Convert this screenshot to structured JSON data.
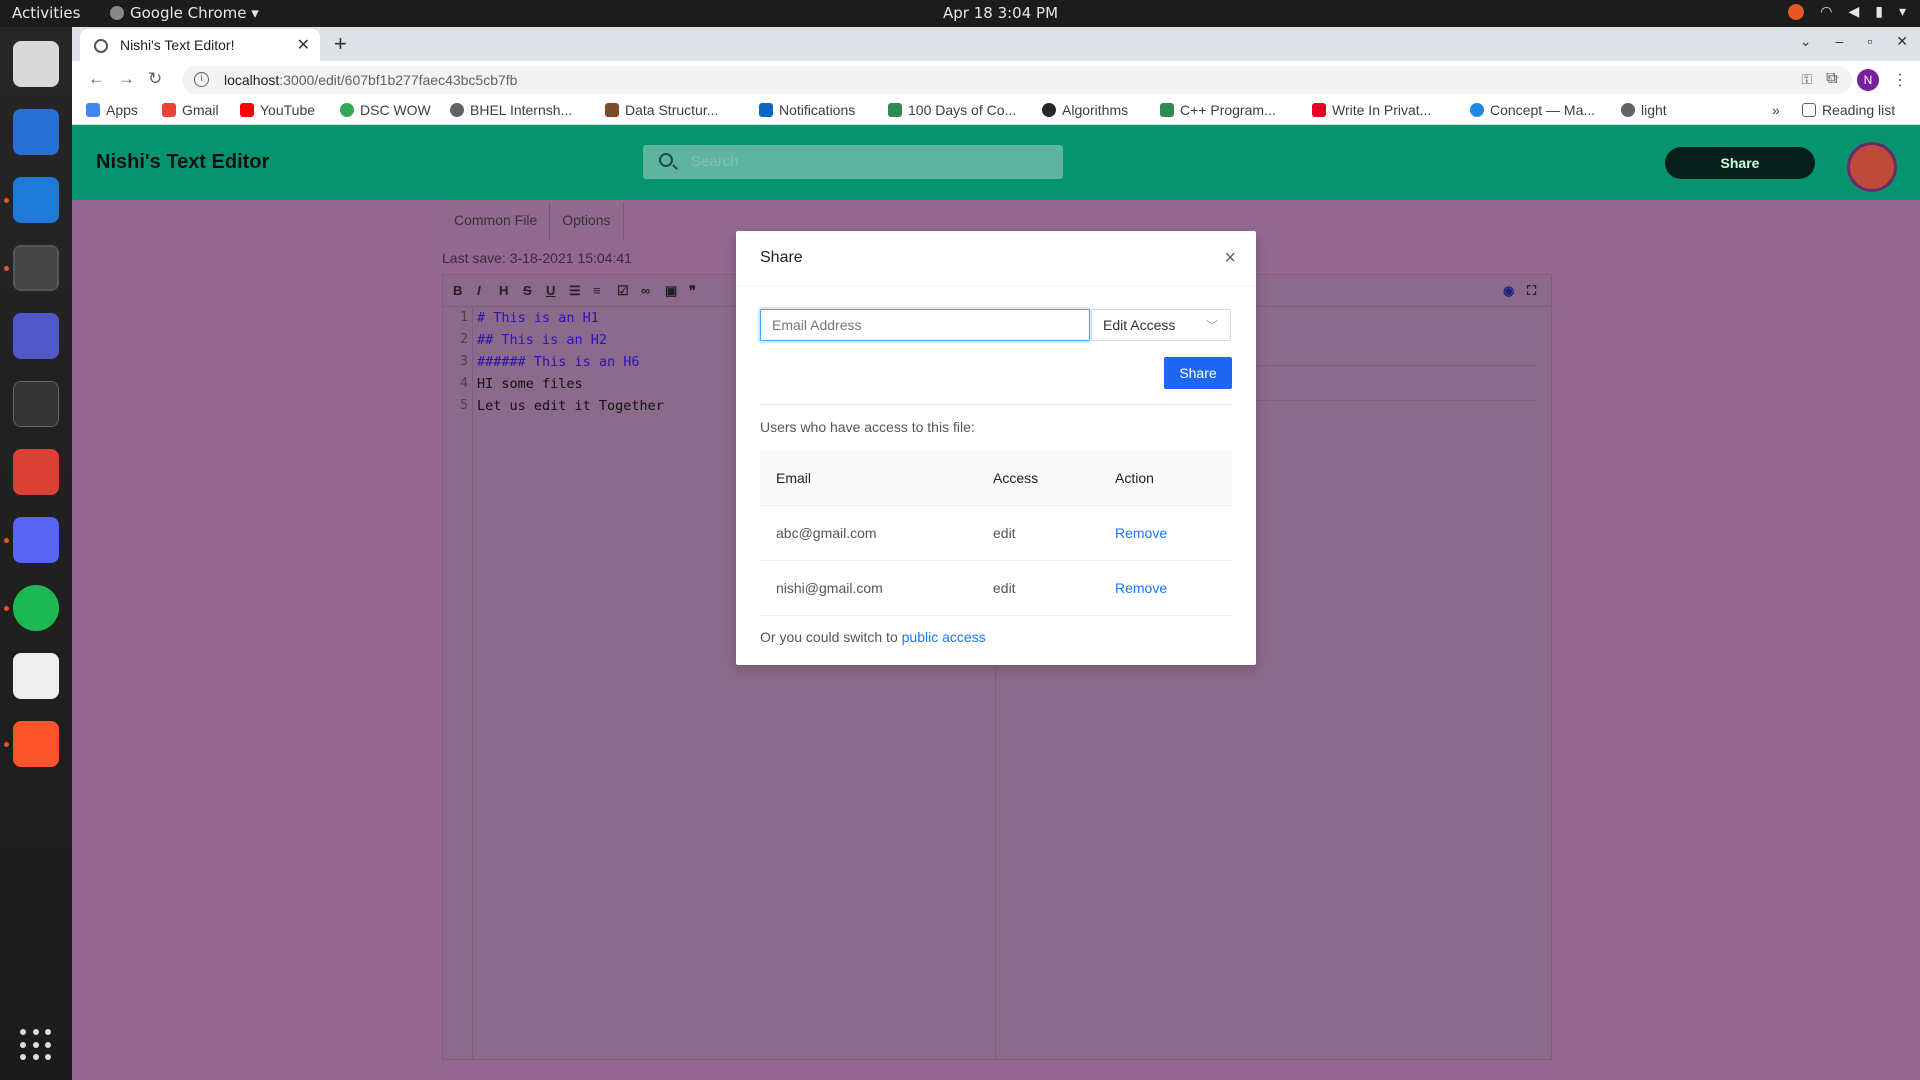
{
  "system": {
    "activities": "Activities",
    "app_name": "Google Chrome",
    "clock": "Apr 18  3:04 PM"
  },
  "browser": {
    "tab_title": "Nishi's Text Editor!",
    "url_host": "localhost",
    "url_rest": ":3000/edit/607bf1b277faec43bc5cb7fb",
    "profile_initial": "N",
    "bookmarks": [
      {
        "label": "Apps",
        "color": "#4285f4"
      },
      {
        "label": "Gmail",
        "color": "#ea4335"
      },
      {
        "label": "YouTube",
        "color": "#ff0000"
      },
      {
        "label": "DSC WOW",
        "color": "#34a853"
      },
      {
        "label": "BHEL Internsh...",
        "color": "#5f6368"
      },
      {
        "label": "Data Structur...",
        "color": "#7a4a2a"
      },
      {
        "label": "Notifications",
        "color": "#0a66c2"
      },
      {
        "label": "100 Days of Co...",
        "color": "#2e8b57"
      },
      {
        "label": "Algorithms",
        "color": "#24292e"
      },
      {
        "label": "C++ Program...",
        "color": "#2e8b57"
      },
      {
        "label": "Write In Privat...",
        "color": "#e60023"
      },
      {
        "label": "Concept — Ma...",
        "color": "#1e88e5"
      },
      {
        "label": "light",
        "color": "#5f6368"
      }
    ],
    "more": "»",
    "reading_list": "Reading list"
  },
  "app": {
    "brand": "Nishi's Text Editor",
    "search_placeholder": "Search",
    "share_button": "Share",
    "file_tabs": [
      "Common File",
      "Options"
    ],
    "last_save": "Last save: 3-18-2021 15:04:41",
    "code_lines": [
      {
        "text": "# This is an H1",
        "heading": true
      },
      {
        "text": "## This is an H2",
        "heading": true
      },
      {
        "text": "###### This is an H6",
        "heading": true
      },
      {
        "text": "HI some files",
        "heading": false
      },
      {
        "text": "Let us edit it Together",
        "heading": false
      }
    ]
  },
  "modal": {
    "title": "Share",
    "close": "×",
    "email_placeholder": "Email Address",
    "access_select": "Edit Access",
    "share_button": "Share",
    "users_text": "Users who have access to this file:",
    "columns": [
      "Email",
      "Access",
      "Action"
    ],
    "rows": [
      {
        "email": "abc@gmail.com",
        "access": "edit",
        "action": "Remove"
      },
      {
        "email": "nishi@gmail.com",
        "access": "edit",
        "action": "Remove"
      }
    ],
    "footer_text": "Or you could switch to ",
    "footer_link": "public access"
  },
  "colors": {
    "header": "#069470",
    "page_overlay": "#946892",
    "primary": "#1d67f2",
    "link": "#1677ff"
  }
}
